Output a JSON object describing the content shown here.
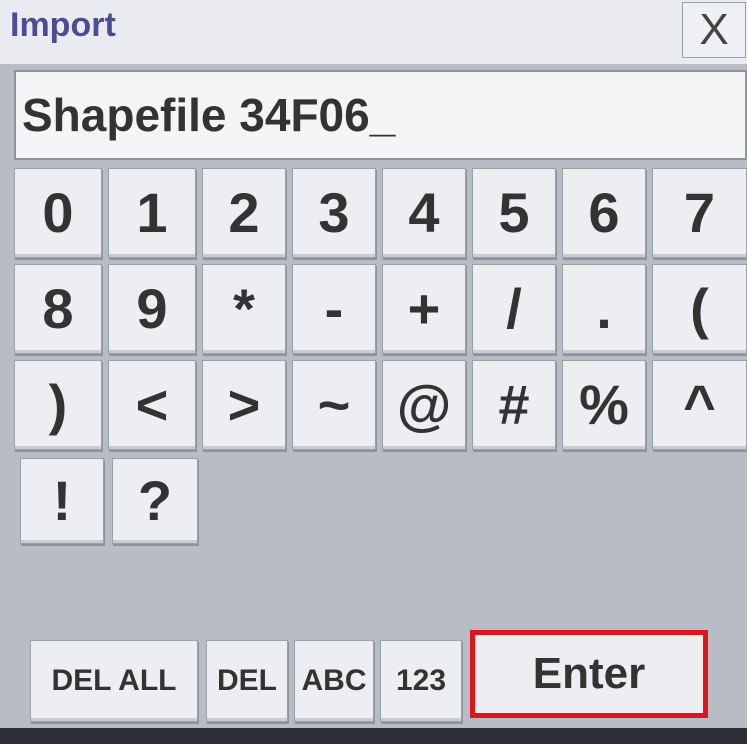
{
  "dialog": {
    "title": "Import",
    "close_label": "X"
  },
  "input": {
    "value": "Shapefile 34F06_"
  },
  "keypad": {
    "row1": [
      "0",
      "1",
      "2",
      "3",
      "4",
      "5",
      "6",
      "7"
    ],
    "row2": [
      "8",
      "9",
      "*",
      "-",
      "+",
      "/",
      ".",
      "("
    ],
    "row3": [
      ")",
      "<",
      ">",
      "~",
      "@",
      "#",
      "%",
      "^"
    ],
    "row4": [
      "!",
      "?"
    ]
  },
  "function_keys": {
    "del_all": "DEL ALL",
    "del": "DEL",
    "abc": "ABC",
    "num": "123",
    "enter": "Enter"
  },
  "highlight": {
    "enter_border_color": "#e0141b"
  }
}
